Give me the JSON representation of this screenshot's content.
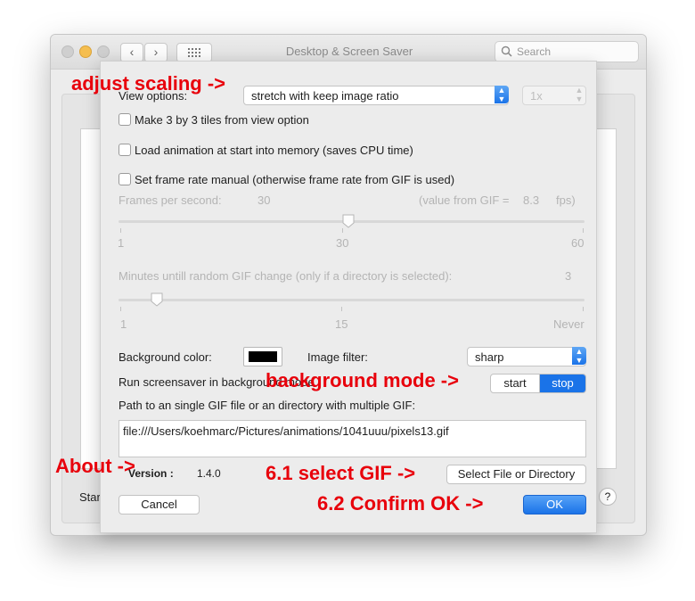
{
  "window": {
    "title": "Desktop & Screen Saver",
    "search_placeholder": "Search",
    "behind_label": "Star",
    "help": "?"
  },
  "view_options": {
    "label": "View options:",
    "selected": "stretch with keep image ratio",
    "scale_value": "1x"
  },
  "checkboxes": {
    "tiles": "Make 3 by 3 tiles from view option",
    "load_memory": "Load animation at start into memory (saves CPU time)",
    "frame_rate_manual": "Set frame rate manual (otherwise frame rate from GIF is used)"
  },
  "fps": {
    "label": "Frames per second:",
    "value": "30",
    "gif_label": "(value from GIF =",
    "gif_value": "8.3",
    "unit": "fps)",
    "ticks": {
      "min": "1",
      "mid": "30",
      "max": "60"
    },
    "slider_value": 30
  },
  "minutes": {
    "label": "Minutes untill random GIF change (only if a directory is selected):",
    "value": "3",
    "ticks": {
      "min": "1",
      "mid": "15",
      "max": "Never"
    }
  },
  "background": {
    "label": "Background color:",
    "color": "#000000"
  },
  "filter": {
    "label": "Image filter:",
    "selected": "sharp"
  },
  "bg_mode": {
    "label": "Run screensaver in background mode",
    "start": "start",
    "stop": "stop"
  },
  "path": {
    "label": "Path to an single GIF file or an directory with multiple GIF:",
    "value": "file:///Users/koehmarc/Pictures/animations/1041uuu/pixels13.gif"
  },
  "version": {
    "label": "Version :",
    "value": "1.4.0"
  },
  "buttons": {
    "select": "Select File or Directory",
    "cancel": "Cancel",
    "ok": "OK"
  },
  "annotations": {
    "scaling": "adjust scaling ->",
    "bg_mode": "background mode ->",
    "about": "About ->",
    "select_gif": "6.1 select GIF ->",
    "confirm": "6.2 Confirm OK ->"
  },
  "colors": {
    "accent": "#1a73e8",
    "annotation": "#e8000b"
  }
}
